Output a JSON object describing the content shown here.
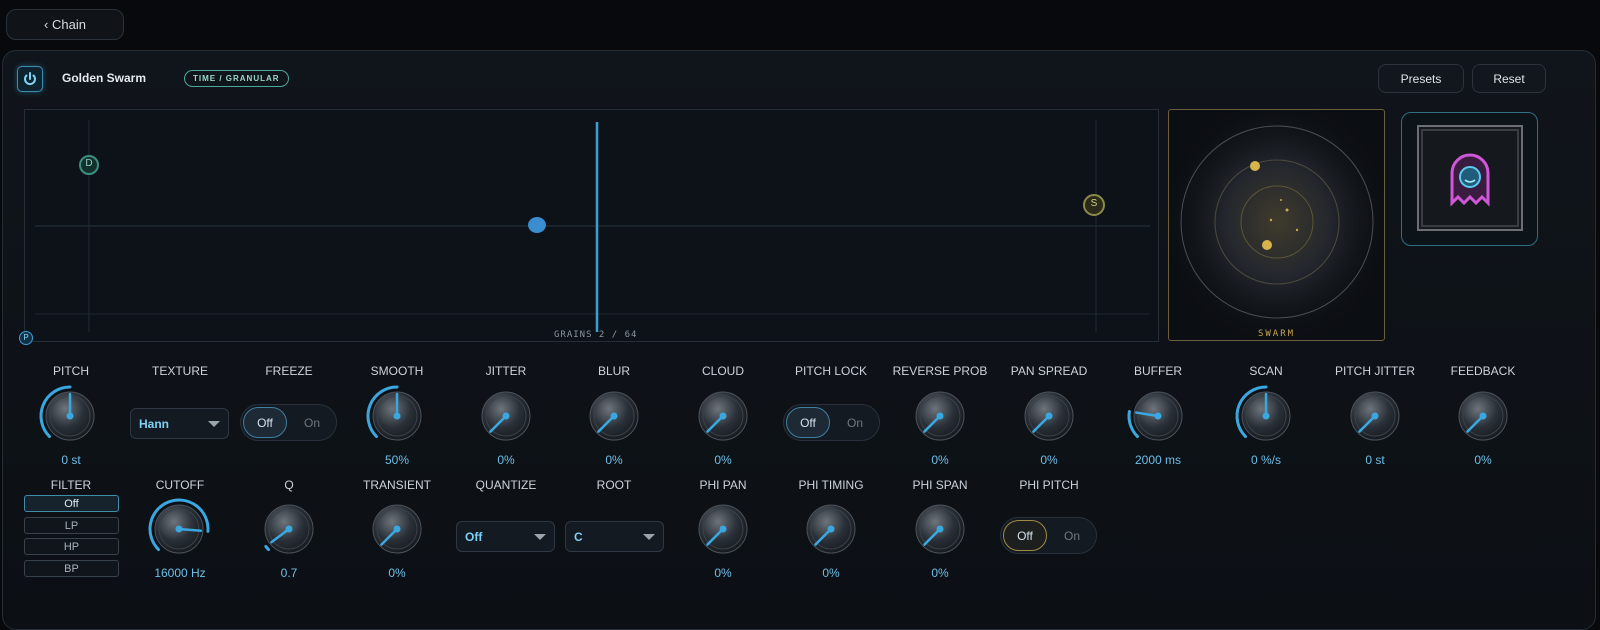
{
  "nav": {
    "back_label": "‹ Chain"
  },
  "header": {
    "title": "Golden Swarm",
    "category_badge": "TIME / GRANULAR",
    "presets_label": "Presets",
    "reset_label": "Reset",
    "power_icon": "power-icon"
  },
  "visualizer": {
    "grains_text": "GRAINS 2 / 64",
    "marker_d": "D",
    "marker_s": "S",
    "marker_p": "P"
  },
  "orbit": {
    "label": "SWARM"
  },
  "colors": {
    "accent": "#3aa8e0",
    "gold": "#c7a653",
    "value_text": "#6ebfe9",
    "ghost_pink": "#d057d8"
  },
  "row1": {
    "pitch": {
      "label": "PITCH",
      "value": "0 st",
      "level": 0.5
    },
    "texture": {
      "label": "TEXTURE",
      "value": "Hann"
    },
    "freeze": {
      "label": "FREEZE",
      "off": "Off",
      "on": "On"
    },
    "smooth": {
      "label": "SMOOTH",
      "value": "50%",
      "level": 0.5
    },
    "jitter": {
      "label": "JITTER",
      "value": "0%",
      "level": 0
    },
    "blur": {
      "label": "BLUR",
      "value": "0%",
      "level": 0
    },
    "cloud": {
      "label": "CLOUD",
      "value": "0%",
      "level": 0
    },
    "pitch_lock": {
      "label": "PITCH LOCK",
      "off": "Off",
      "on": "On"
    },
    "reverse_prob": {
      "label": "REVERSE PROB",
      "value": "0%",
      "level": 0
    },
    "pan_spread": {
      "label": "PAN SPREAD",
      "value": "0%",
      "level": 0
    },
    "buffer": {
      "label": "BUFFER",
      "value": "2000 ms",
      "level": 0.2
    },
    "scan": {
      "label": "SCAN",
      "value": "0 %/s",
      "level": 0.5
    },
    "pitch_jitter": {
      "label": "PITCH JITTER",
      "value": "0 st",
      "level": 0
    },
    "feedback": {
      "label": "FEEDBACK",
      "value": "0%",
      "level": 0
    }
  },
  "row2": {
    "filter": {
      "label": "FILTER",
      "options": [
        "Off",
        "LP",
        "HP",
        "BP"
      ]
    },
    "cutoff": {
      "label": "CUTOFF",
      "value": "16000 Hz",
      "level": 0.85
    },
    "q": {
      "label": "Q",
      "value": "0.7",
      "level": 0.03
    },
    "transient": {
      "label": "TRANSIENT",
      "value": "0%",
      "level": 0
    },
    "quantize": {
      "label": "QUANTIZE",
      "value": "Off"
    },
    "root": {
      "label": "ROOT",
      "value": "C"
    },
    "phi_pan": {
      "label": "PHI PAN",
      "value": "0%",
      "level": 0
    },
    "phi_timing": {
      "label": "PHI TIMING",
      "value": "0%",
      "level": 0
    },
    "phi_span": {
      "label": "PHI SPAN",
      "value": "0%",
      "level": 0
    },
    "phi_pitch": {
      "label": "PHI PITCH",
      "off": "Off",
      "on": "On"
    }
  }
}
